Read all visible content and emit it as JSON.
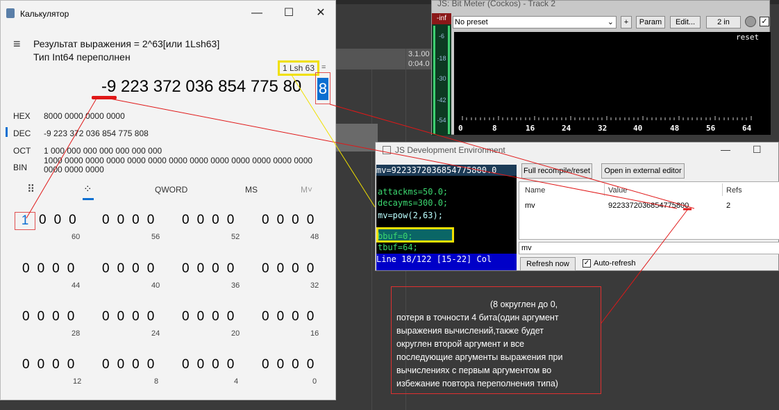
{
  "calculator": {
    "title": "Калькулятор",
    "window_buttons": {
      "minimize": "—",
      "maximize": "☐",
      "close": "✕"
    },
    "menu_icon": "≡",
    "error_line1": "Результат выражения = 2^63[или 1Lsh63]",
    "error_line2": "Тип Int64 переполнен",
    "expression": "1 Lsh 63",
    "expression_close": "=",
    "display_value": "-9 223 372 036 854 775 80",
    "display_last_digit": "8",
    "radix": [
      {
        "label": "HEX",
        "value": "8000 0000 0000 0000"
      },
      {
        "label": "DEC",
        "value": "-9 223 372 036 854 775 808"
      },
      {
        "label": "OCT",
        "value": "1 000 000 000 000 000 000 000"
      },
      {
        "label": "BIN",
        "value": "1000 0000 0000 0000 0000 0000 0000 0000 0000 0000 0000 0000 0000 0000 0000 0000"
      }
    ],
    "toolbar": {
      "keypad_icon": "⠿",
      "bits_icon": "⁘",
      "word": "QWORD",
      "ms": "MS",
      "mv": "M˅"
    },
    "bit_rows": [
      {
        "groups": [
          "1 0 0 0",
          "0 0 0 0",
          "0 0 0 0",
          "0 0 0 0"
        ],
        "labels": [
          "60",
          "56",
          "52",
          "48"
        ]
      },
      {
        "groups": [
          "0 0 0 0",
          "0 0 0 0",
          "0 0 0 0",
          "0 0 0 0"
        ],
        "labels": [
          "44",
          "40",
          "36",
          "32"
        ]
      },
      {
        "groups": [
          "0 0 0 0",
          "0 0 0 0",
          "0 0 0 0",
          "0 0 0 0"
        ],
        "labels": [
          "28",
          "24",
          "20",
          "16"
        ]
      },
      {
        "groups": [
          "0 0 0 0",
          "0 0 0 0",
          "0 0 0 0",
          "0 0 0 0"
        ],
        "labels": [
          "12",
          "8",
          "4",
          "0"
        ]
      }
    ],
    "first_bit": "1"
  },
  "daw": {
    "time1": "3.1.00",
    "time2": "0:04.0"
  },
  "bit_meter": {
    "title": "JS: Bit Meter (Cockos) - Track 2",
    "vu_top": "-inf",
    "vu_labels": [
      "-6",
      "-18",
      "-30",
      "-42",
      "-54"
    ],
    "preset": "No preset",
    "plus": "+",
    "param": "Param",
    "edit": "Edit...",
    "io": "2 in",
    "reset": "reset",
    "scale": [
      "0",
      "8",
      "16",
      "24",
      "32",
      "40",
      "48",
      "56",
      "64"
    ]
  },
  "js_dev": {
    "title": "JS Development Environment",
    "header_line": "mv=9223372036854775800.0",
    "code_lines": [
      "",
      "attackms=50.0;",
      "decayms=300.0;",
      "mv=pow(2,63);",
      "",
      "bbuf=0;",
      "tbuf=64;"
    ],
    "status": "Line 18/122 [15-22] Col",
    "full_recompile": "Full recompile/reset",
    "open_external": "Open in external editor",
    "columns": {
      "name": "Name",
      "value": "Value",
      "refs": "Refs"
    },
    "row": {
      "name": "mv",
      "value": "9223372036854775800",
      "refs": "2"
    },
    "filter": "mv",
    "refresh_now": "Refresh now",
    "auto_refresh": "Auto-refresh",
    "auto_checked": "✓"
  },
  "note": {
    "line1": "(8 округлен до 0,",
    "line2": "потеря в точности  4 бита(один аргумент",
    "line3": "выражения вычислений,также будет",
    "line4": "округлен второй аргумент и все",
    "line5": "последующие аргументы выражения при",
    "line6": "вычислениях с первым аргументом во",
    "line7": "избежание повтора переполнения типа)"
  },
  "colors": {
    "accent": "#0d6fd1",
    "annotation_red": "#e01818",
    "annotation_yellow": "#f0e000",
    "code_green": "#3cd870",
    "status_blue": "#0000c8"
  }
}
